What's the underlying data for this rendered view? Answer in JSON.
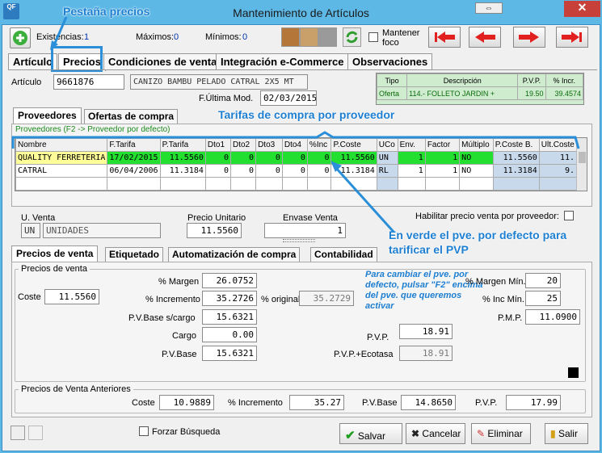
{
  "window": {
    "title": "Mantenimiento de Artículos",
    "app_icon": "QF",
    "close_label": "✕",
    "restore_label": "⇔"
  },
  "annotations": {
    "pestana": "Pestaña precios",
    "tarifas": "Tarifas de compra por proveedor",
    "verde_line1": "En verde el pve. por defecto para",
    "verde_line2": "tarificar el PVP",
    "cambiar": "Para cambiar el pve. por defecto, pulsar \"F2\" encima del pve. que queremos activar"
  },
  "toolbar": {
    "existencias_label": "Existencias:",
    "existencias_value": "1",
    "maximos_label": "Máximos:",
    "maximos_value": "0",
    "minimos_label": "Mínimos:",
    "minimos_value": "0",
    "mantener_foco": "Mantener foco"
  },
  "top_tabs": [
    "Artículo",
    "Precios",
    "Condiciones de venta",
    "Integración e-Commerce",
    "Observaciones"
  ],
  "articulo": {
    "label": "Artículo",
    "code": "9661876",
    "description": "CANIZO BAMBU PELADO CATRAL 2X5 MT",
    "ultima_mod_label": "F.Última Mod.",
    "ultima_mod_value": "02/03/2015"
  },
  "offer_table": {
    "headers": [
      "Tipo",
      "Descripción",
      "P.V.P.",
      "% Incr."
    ],
    "row": [
      "Oferta",
      "114.- FOLLETO JARDIN +",
      "19.50",
      "39.4574"
    ]
  },
  "inner_tabs": [
    "Proveedores",
    "Ofertas de compra"
  ],
  "proveedores_hint": "Proveedores (F2 -> Proveedor por defecto)",
  "grid": {
    "headers": [
      "Nombre",
      "F.Tarifa",
      "P.Tarifa",
      "Dto1",
      "Dto2",
      "Dto3",
      "Dto4",
      "%Inc",
      "P.Coste",
      "UCo",
      "Env.",
      "Factor",
      "Múltiplo",
      "P.Coste B.",
      "Ult.Coste"
    ],
    "rows": [
      [
        "QUALITY FERRETERIA",
        "17/02/2015",
        "11.5560",
        "0",
        "0",
        "0",
        "0",
        "0",
        "11.5560",
        "UN",
        "1",
        "1",
        "NO",
        "11.5560",
        "11."
      ],
      [
        "CATRAL",
        "06/04/2006",
        "11.3184",
        "0",
        "0",
        "0",
        "0",
        "0",
        "11.3184",
        "RL",
        "1",
        "1",
        "NO",
        "11.3184",
        "9."
      ]
    ]
  },
  "venta": {
    "u_venta_label": "U. Venta",
    "u_code": "UN",
    "u_desc": "UNIDADES",
    "precio_unitario_label": "Precio Unitario",
    "precio_unitario": "11.5560",
    "envase_label": "Envase Venta",
    "envase": "1",
    "habilitar_label": "Habilitar precio venta por proveedor:"
  },
  "bottom_tabs": [
    "Precios de venta",
    "Etiquetado",
    "Automatización de compra",
    "Contabilidad"
  ],
  "precios_venta": {
    "group_title": "Precios de venta",
    "coste_label": "Coste",
    "coste": "11.5560",
    "margen_label": "% Margen",
    "margen": "26.0752",
    "incremento_label": "% Incremento",
    "incremento": "35.2726",
    "original_label": "% original",
    "original": "35.2729",
    "pvbase_sc_label": "P.V.Base s/cargo",
    "pvbase_sc": "15.6321",
    "cargo_label": "Cargo",
    "cargo": "0.00",
    "pvbase_label": "P.V.Base",
    "pvbase": "15.6321",
    "margen_min_label": "% Margen Mín.",
    "margen_min": "20",
    "inc_min_label": "% Inc Mín.",
    "inc_min": "25",
    "pmp_label": "P.M.P.",
    "pmp": "11.0900",
    "pvp_label": "P.V.P.",
    "pvp": "18.91",
    "pvp_eco_label": "P.V.P.+Ecotasa",
    "pvp_eco": "18.91"
  },
  "anteriores": {
    "group_title": "Precios de Venta Anteriores",
    "coste_label": "Coste",
    "coste": "10.9889",
    "incremento_label": "% Incremento",
    "incremento": "35.27",
    "pvbase_label": "P.V.Base",
    "pvbase": "14.8650",
    "pvp_label": "P.V.P.",
    "pvp": "17.99"
  },
  "footer": {
    "forzar_label": "Forzar Búsqueda",
    "salvar": "Salvar",
    "cancelar": "Cancelar",
    "eliminar": "Eliminar",
    "salir": "Salir"
  },
  "colors": {
    "accent": "#1e7fd1",
    "default_supplier_row": "#23e030",
    "close_button": "#c7403a",
    "nav_arrow": "#e32020"
  }
}
